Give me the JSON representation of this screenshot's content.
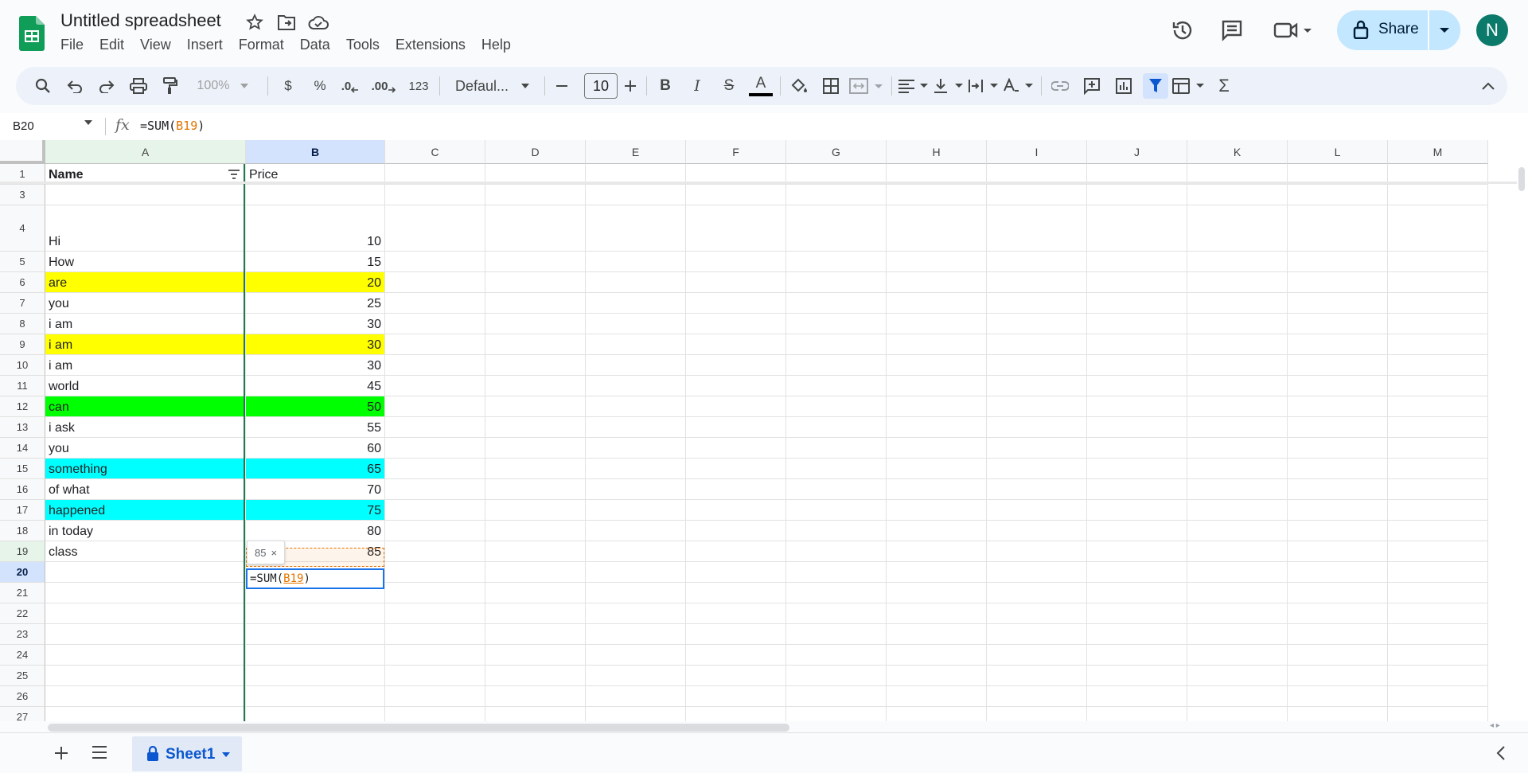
{
  "app": {
    "title": "Untitled spreadsheet",
    "menus": [
      "File",
      "Edit",
      "View",
      "Insert",
      "Format",
      "Data",
      "Tools",
      "Extensions",
      "Help"
    ],
    "share_label": "Share",
    "avatar_initial": "N"
  },
  "toolbar": {
    "zoom": "100%",
    "currency": "$",
    "percent": "%",
    "decrease_decimal": ".0",
    "increase_decimal": ".00",
    "number_format": "123",
    "font": "Defaul...",
    "font_size": "10",
    "colors": {
      "text_color_bar": "#000000",
      "fill_icon": "#444746"
    }
  },
  "formula_bar": {
    "name_box": "B20",
    "fx": "fx",
    "formula_prefix": "=SUM(",
    "formula_ref": "B19",
    "formula_suffix": ")"
  },
  "columns": [
    "A",
    "B",
    "C",
    "D",
    "E",
    "F",
    "G",
    "H",
    "I",
    "J",
    "K",
    "L",
    "M"
  ],
  "rows": [
    {
      "n": "1",
      "a": "Name",
      "b": "Price",
      "fill": "",
      "bold_a": true
    },
    {
      "n": "3",
      "a": "",
      "b": "",
      "fill": ""
    },
    {
      "n": "4",
      "a": "Hi",
      "b": "10",
      "fill": ""
    },
    {
      "n": "5",
      "a": "How",
      "b": "15",
      "fill": ""
    },
    {
      "n": "6",
      "a": "are",
      "b": "20",
      "fill": "#ffff00"
    },
    {
      "n": "7",
      "a": "you",
      "b": "25",
      "fill": ""
    },
    {
      "n": "8",
      "a": "i am",
      "b": "30",
      "fill": ""
    },
    {
      "n": "9",
      "a": "i am",
      "b": "30",
      "fill": "#ffff00"
    },
    {
      "n": "10",
      "a": "i am",
      "b": "30",
      "fill": ""
    },
    {
      "n": "11",
      "a": "world",
      "b": "45",
      "fill": ""
    },
    {
      "n": "12",
      "a": "can",
      "b": "50",
      "fill": "#00ff00"
    },
    {
      "n": "13",
      "a": "i ask",
      "b": "55",
      "fill": ""
    },
    {
      "n": "14",
      "a": "you",
      "b": "60",
      "fill": ""
    },
    {
      "n": "15",
      "a": "something",
      "b": "65",
      "fill": "#00ffff"
    },
    {
      "n": "16",
      "a": "of what",
      "b": "70",
      "fill": ""
    },
    {
      "n": "17",
      "a": "happened",
      "b": "75",
      "fill": "#00ffff"
    },
    {
      "n": "18",
      "a": "in today",
      "b": "80",
      "fill": ""
    },
    {
      "n": "19",
      "a": "class",
      "b": "85",
      "fill": ""
    },
    {
      "n": "20",
      "a": "",
      "b": "",
      "fill": ""
    },
    {
      "n": "21",
      "a": "",
      "b": "",
      "fill": ""
    },
    {
      "n": "22",
      "a": "",
      "b": "",
      "fill": ""
    },
    {
      "n": "23",
      "a": "",
      "b": "",
      "fill": ""
    },
    {
      "n": "24",
      "a": "",
      "b": "",
      "fill": ""
    },
    {
      "n": "25",
      "a": "",
      "b": "",
      "fill": ""
    },
    {
      "n": "26",
      "a": "",
      "b": "",
      "fill": ""
    },
    {
      "n": "27",
      "a": "",
      "b": "",
      "fill": ""
    }
  ],
  "editor": {
    "prefix": "=SUM(",
    "ref": "B19",
    "suffix": ")",
    "tooltip": "85",
    "tooltip_close": "×"
  },
  "sheet_tab": {
    "label": "Sheet1"
  }
}
